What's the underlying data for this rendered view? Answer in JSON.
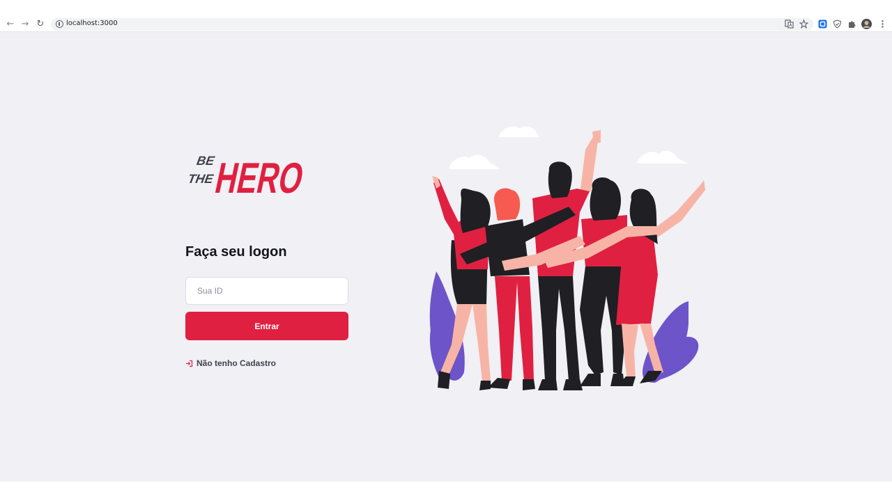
{
  "browser": {
    "url": "localhost:3000",
    "icons": [
      "back-icon",
      "forward-icon",
      "reload-icon",
      "info-icon",
      "translate-icon",
      "star-icon",
      "extension-blue-icon",
      "shield-icon",
      "puzzle-icon",
      "profile-avatar",
      "menu-dots-icon"
    ]
  },
  "logo": {
    "line1": "BE",
    "line2": "THE",
    "word": "HERO"
  },
  "login": {
    "title": "Faça seu logon",
    "id_placeholder": "Sua ID",
    "id_value": "",
    "submit_label": "Entrar",
    "register_label": "Não tenho Cadastro"
  },
  "colors": {
    "brand": "#e02041",
    "background": "#f0f0f5",
    "text_dark": "#13131a",
    "text_muted": "#41414d"
  },
  "illustration": {
    "description_icon": "heroes-illustration"
  }
}
